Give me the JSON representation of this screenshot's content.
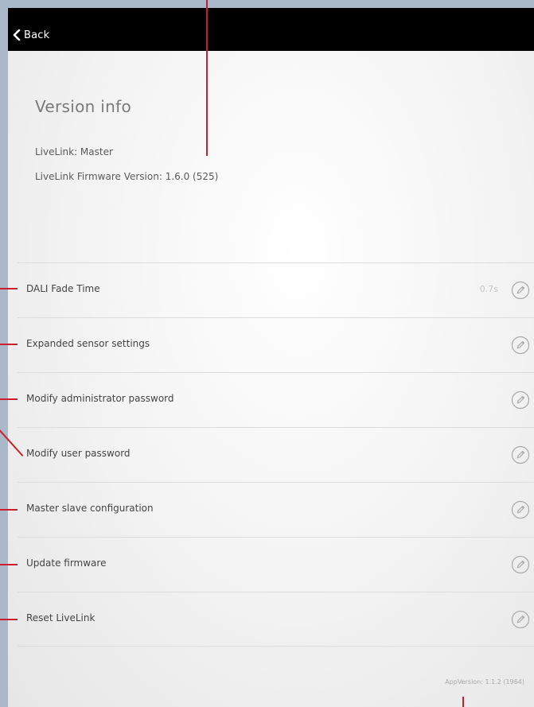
{
  "header": {
    "back_label": "Back"
  },
  "page": {
    "title": "Version info",
    "livelink_line": "LiveLink: Master",
    "firmware_line": "LiveLink Firmware Version: 1.6.0 (525)"
  },
  "settings": {
    "items": [
      {
        "label": "DALI Fade Time",
        "value": "0.7s",
        "icon": "pencil-edit-icon"
      },
      {
        "label": "Expanded sensor settings",
        "value": "",
        "icon": "pencil-edit-icon"
      },
      {
        "label": "Modify administrator password",
        "value": "",
        "icon": "pencil-edit-icon"
      },
      {
        "label": "Modify user password",
        "value": "",
        "icon": "pencil-edit-icon"
      },
      {
        "label": "Master slave configuration",
        "value": "",
        "icon": "pencil-edit-icon"
      },
      {
        "label": "Update firmware",
        "value": "",
        "icon": "pencil-edit-icon"
      },
      {
        "label": "Reset LiveLink",
        "value": "",
        "icon": "pencil-edit-icon"
      }
    ]
  },
  "footer": {
    "app_version": "AppVersion: 1.1.2 (1964)"
  },
  "colors": {
    "callout": "#cc1d2f",
    "background": "#aab9c9",
    "topbar": "#000000"
  }
}
